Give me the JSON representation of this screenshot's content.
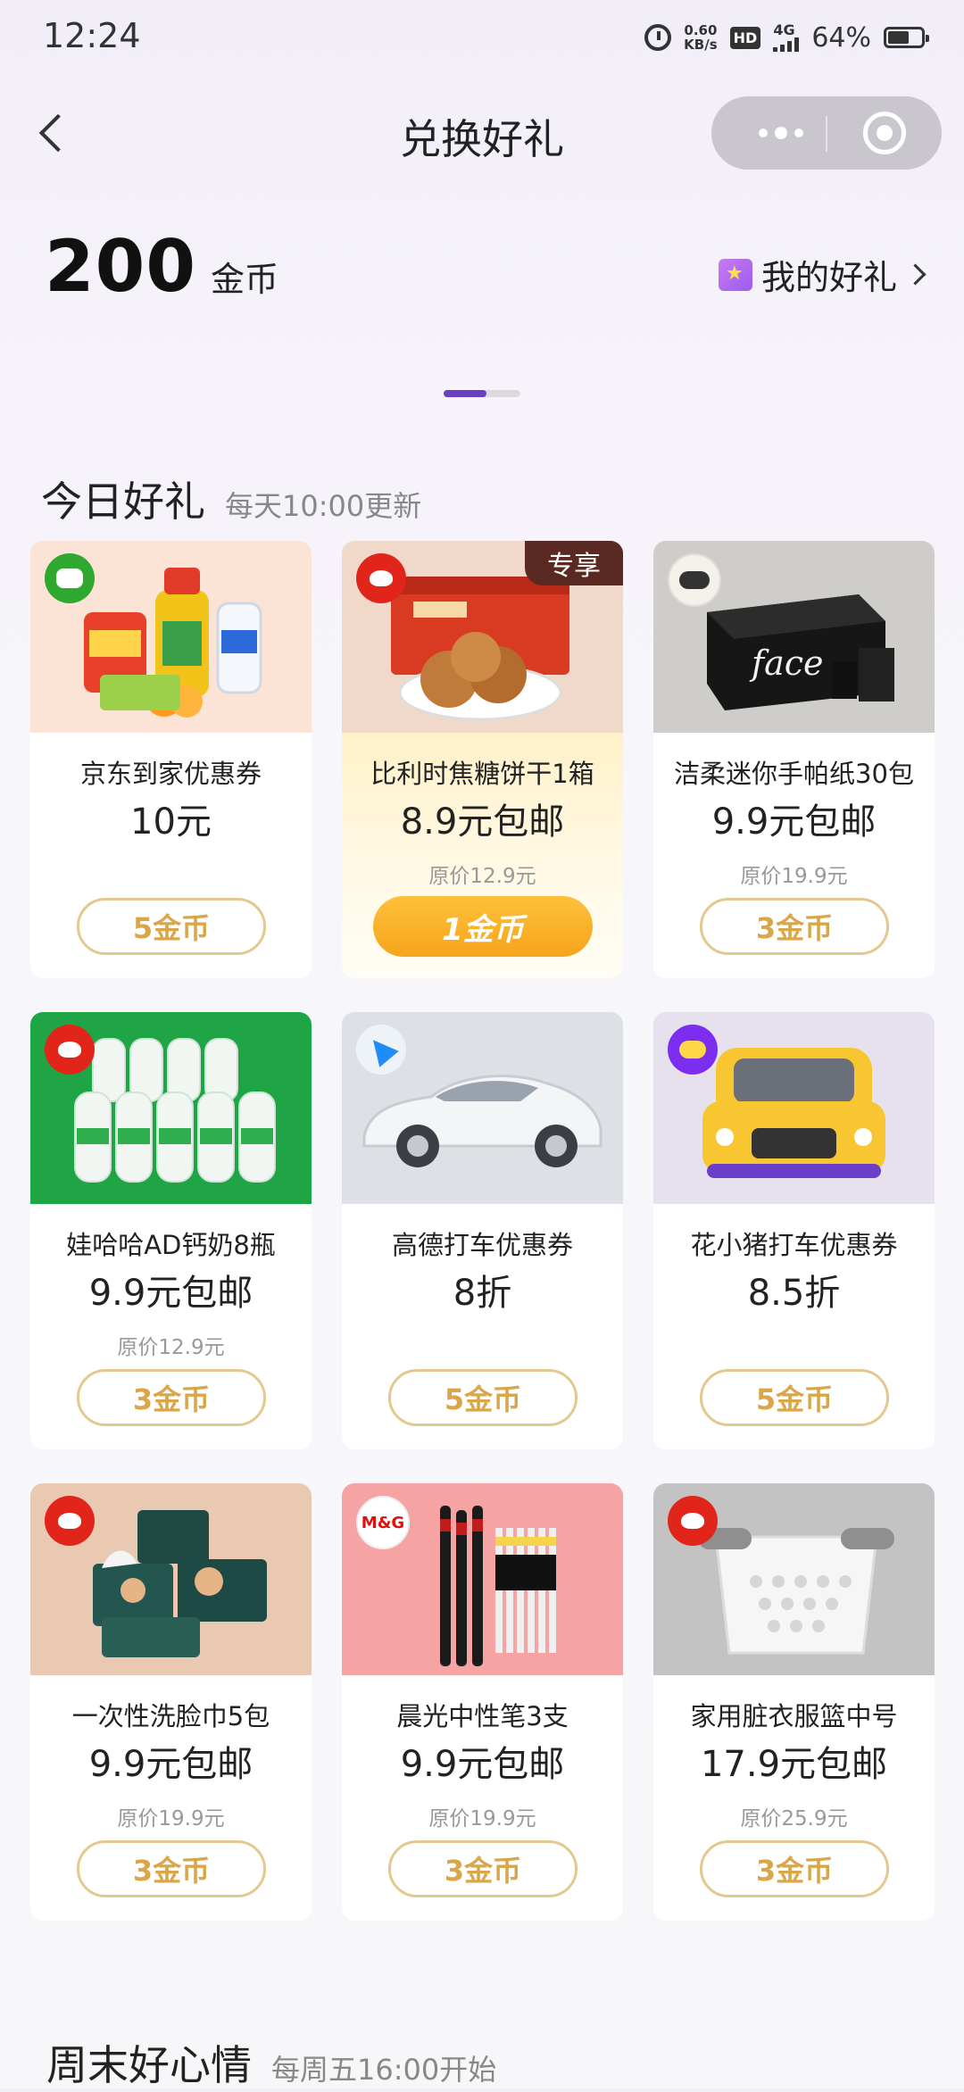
{
  "status_bar": {
    "time": "12:24",
    "net_speed_value": "0.60",
    "net_speed_unit": "KB/s",
    "hd_label": "HD",
    "network": "4G",
    "battery": "64%"
  },
  "nav": {
    "title": "兑换好礼"
  },
  "wallet": {
    "coins": "200",
    "coins_unit": "金币",
    "my_gifts_label": "我的好礼"
  },
  "sections": {
    "today": {
      "title": "今日好礼",
      "subtitle": "每天10:00更新"
    },
    "weekend": {
      "title": "周末好心情",
      "subtitle": "每周五16:00开始"
    }
  },
  "products": [
    {
      "name": "京东到家优惠券",
      "price": "10元",
      "original": "",
      "cost": "5金币",
      "logo": "jd-home-logo"
    },
    {
      "name": "比利时焦糖饼干1箱",
      "price": "8.9元包邮",
      "original": "原价12.9元",
      "cost": "1金币",
      "tag": "专享",
      "logo": "jd-logo"
    },
    {
      "name": "洁柔迷你手帕纸30包",
      "price": "9.9元包邮",
      "original": "原价19.9元",
      "cost": "3金币",
      "logo": "jierou-logo"
    },
    {
      "name": "娃哈哈AD钙奶8瓶",
      "price": "9.9元包邮",
      "original": "原价12.9元",
      "cost": "3金币",
      "logo": "jd-logo"
    },
    {
      "name": "高德打车优惠券",
      "price": "8折",
      "original": "",
      "cost": "5金币",
      "logo": "amap-logo"
    },
    {
      "name": "花小猪打车优惠券",
      "price": "8.5折",
      "original": "",
      "cost": "5金币",
      "logo": "huaxiaozhu-logo"
    },
    {
      "name": "一次性洗脸巾5包",
      "price": "9.9元包邮",
      "original": "原价19.9元",
      "cost": "3金币",
      "logo": "jd-logo"
    },
    {
      "name": "晨光中性笔3支",
      "price": "9.9元包邮",
      "original": "原价19.9元",
      "cost": "3金币",
      "logo": "mg-logo",
      "logo_text": "M&G"
    },
    {
      "name": "家用脏衣服篮中号",
      "price": "17.9元包邮",
      "original": "原价25.9元",
      "cost": "3金币",
      "logo": "jd-logo"
    }
  ]
}
